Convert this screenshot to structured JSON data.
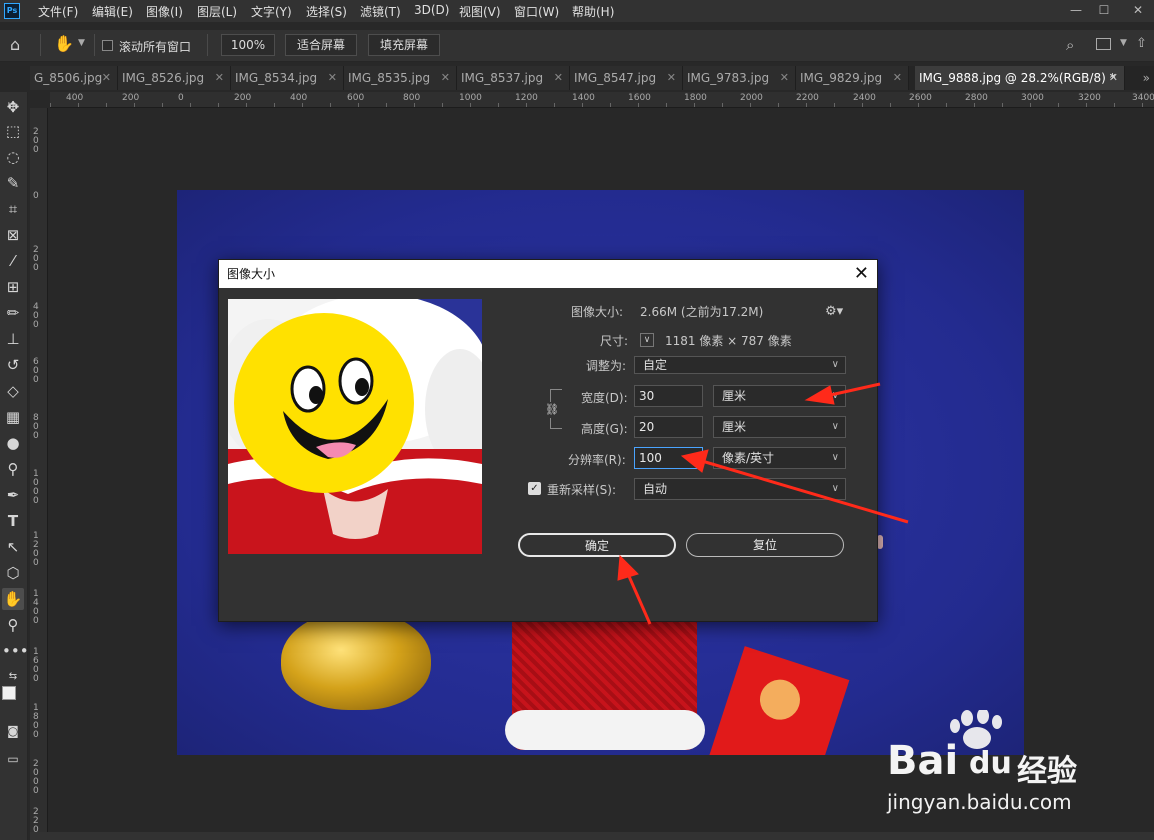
{
  "menu": [
    "文件(F)",
    "编辑(E)",
    "图像(I)",
    "图层(L)",
    "文字(Y)",
    "选择(S)",
    "滤镜(T)",
    "3D(D)",
    "视图(V)",
    "窗口(W)",
    "帮助(H)"
  ],
  "app_logo": "Ps",
  "options": {
    "scroll_all": "滚动所有窗口",
    "zoom_value": "100%",
    "fit_screen": "适合屏幕",
    "fill_screen": "填充屏幕"
  },
  "tabs": [
    {
      "label": "G_8506.jpg",
      "active": false
    },
    {
      "label": "IMG_8526.jpg",
      "active": false
    },
    {
      "label": "IMG_8534.jpg",
      "active": false
    },
    {
      "label": "IMG_8535.jpg",
      "active": false
    },
    {
      "label": "IMG_8537.jpg",
      "active": false
    },
    {
      "label": "IMG_8547.jpg",
      "active": false
    },
    {
      "label": "IMG_9783.jpg",
      "active": false
    },
    {
      "label": "IMG_9829.jpg",
      "active": false
    },
    {
      "label": "IMG_9888.jpg @ 28.2%(RGB/8) *",
      "active": true
    }
  ],
  "ruler_h": [
    "400",
    "200",
    "0",
    "200",
    "400",
    "600",
    "800",
    "1000",
    "1200",
    "1400",
    "1600",
    "1800",
    "2000",
    "2200",
    "2400",
    "2600",
    "2800",
    "3000",
    "3200",
    "3400"
  ],
  "ruler_v": [
    "200",
    "0",
    "200",
    "400",
    "600",
    "800",
    "1000",
    "1200",
    "1400",
    "1600",
    "1800",
    "2000",
    "2200"
  ],
  "dialog": {
    "title": "图像大小",
    "image_size_label": "图像大小:",
    "image_size_value": "2.66M (之前为17.2M)",
    "dimensions_label": "尺寸:",
    "dimensions_value": "1181 像素 × 787 像素",
    "fit_to_label": "调整为:",
    "fit_to_value": "自定",
    "width_label": "宽度(D):",
    "width_value": "30",
    "width_unit": "厘米",
    "height_label": "高度(G):",
    "height_value": "20",
    "height_unit": "厘米",
    "resolution_label": "分辨率(R):",
    "resolution_value": "100",
    "resolution_unit": "像素/英寸",
    "resample_label": "重新采样(S):",
    "resample_value": "自动",
    "resample_checked": true,
    "ok_button": "确定",
    "reset_button": "复位"
  },
  "watermark": {
    "brand_left": "Bai",
    "brand_mid": "du",
    "brand_right": "经验",
    "url": "jingyan.baidu.com"
  },
  "colors": {
    "annotation_arrow": "#ff2a1a",
    "focus_border": "#4aa4ff",
    "backdrop_blue": "#232b8f"
  }
}
